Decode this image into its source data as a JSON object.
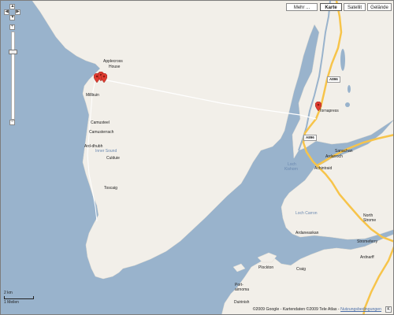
{
  "map_type_buttons": [
    {
      "label": "Mehr ..."
    },
    {
      "label": "Karte",
      "active": true
    },
    {
      "label": "Satellit"
    },
    {
      "label": "Gelände"
    }
  ],
  "zoom_controls": {
    "zoom_in_icon": "plus-icon",
    "zoom_out_icon": "minus-icon",
    "pan_icons": [
      "arrow-up-icon",
      "arrow-left-icon",
      "arrow-right-icon",
      "arrow-down-icon"
    ]
  },
  "places": [
    {
      "name": "Applecross"
    },
    {
      "name": "House"
    },
    {
      "name": "Millbuin"
    },
    {
      "name": "Camusteel"
    },
    {
      "name": "Camusterrach"
    },
    {
      "name": "Ard-dhubh"
    },
    {
      "name": "Inner Sound"
    },
    {
      "name": "Culduie"
    },
    {
      "name": "Toscaig"
    },
    {
      "name": "Tornapress"
    },
    {
      "name": "Sanachan"
    },
    {
      "name": "Ardarroch"
    },
    {
      "name": "Achintraid"
    },
    {
      "name": "Loch"
    },
    {
      "name": "Kishorn"
    },
    {
      "name": "Loch Carron"
    },
    {
      "name": "Ardaneaskan"
    },
    {
      "name": "North"
    },
    {
      "name": "Strome"
    },
    {
      "name": "Stromeferry"
    },
    {
      "name": "Ardnarff"
    },
    {
      "name": "Plockton"
    },
    {
      "name": "Craig"
    },
    {
      "name": "Port-"
    },
    {
      "name": "airnoma"
    },
    {
      "name": "Duirinish"
    }
  ],
  "road_labels": [
    "A896",
    "A896"
  ],
  "markers": [
    {
      "name": "applecross-marker-1"
    },
    {
      "name": "applecross-marker-2"
    },
    {
      "name": "applecross-marker-3"
    },
    {
      "name": "tornapress-marker"
    }
  ],
  "scale": {
    "km": "2 km",
    "miles": "1 Meilen"
  },
  "attribution": {
    "text": "©2009 Google - Kartendaten ©2009 Tele Atlas - ",
    "link": "Nutzungsbedingungen"
  },
  "colors": {
    "water": "#99b3cc",
    "land": "#f2efe9",
    "road": "#f7c44a",
    "marker": "#e03c31"
  }
}
